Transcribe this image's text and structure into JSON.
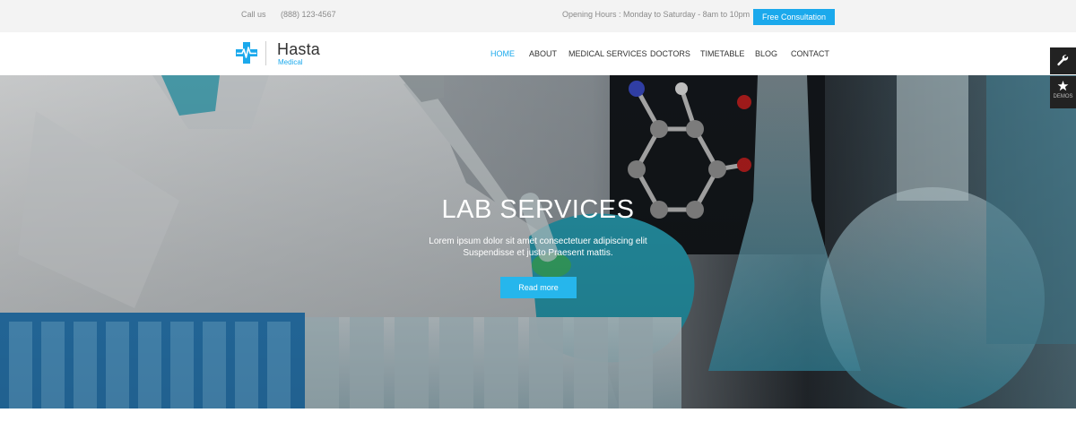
{
  "topbar": {
    "call_label": "Call us",
    "phone": "(888) 123-4567",
    "hours": "Opening Hours : Monday to Saturday - 8am to 10pm",
    "cta_label": "Free Consultation"
  },
  "brand": {
    "name": "Hasta",
    "tagline": "Medical",
    "logo_icon": "medical-cross-ecg-icon"
  },
  "nav": {
    "items": [
      {
        "label": "HOME",
        "active": true
      },
      {
        "label": "ABOUT",
        "active": false
      },
      {
        "label": "MEDICAL SERVICES",
        "active": false
      },
      {
        "label": "DOCTORS",
        "active": false
      },
      {
        "label": "TIMETABLE",
        "active": false
      },
      {
        "label": "BLOG",
        "active": false
      },
      {
        "label": "CONTACT",
        "active": false
      }
    ]
  },
  "hero": {
    "title": "LAB SERVICES",
    "text_line1": "Lorem ipsum dolor sit amet consectetuer adipiscing elit",
    "text_line2": "Suspendisse et justo Praesent mattis.",
    "button_label": "Read more"
  },
  "side": {
    "tool_icon": "wrench-icon",
    "demos_icon": "star-icon",
    "demos_label": "DEMOS"
  },
  "colors": {
    "accent": "#1ba9ec",
    "topbar_bg": "#f3f3f3",
    "side_bg": "#222222"
  }
}
